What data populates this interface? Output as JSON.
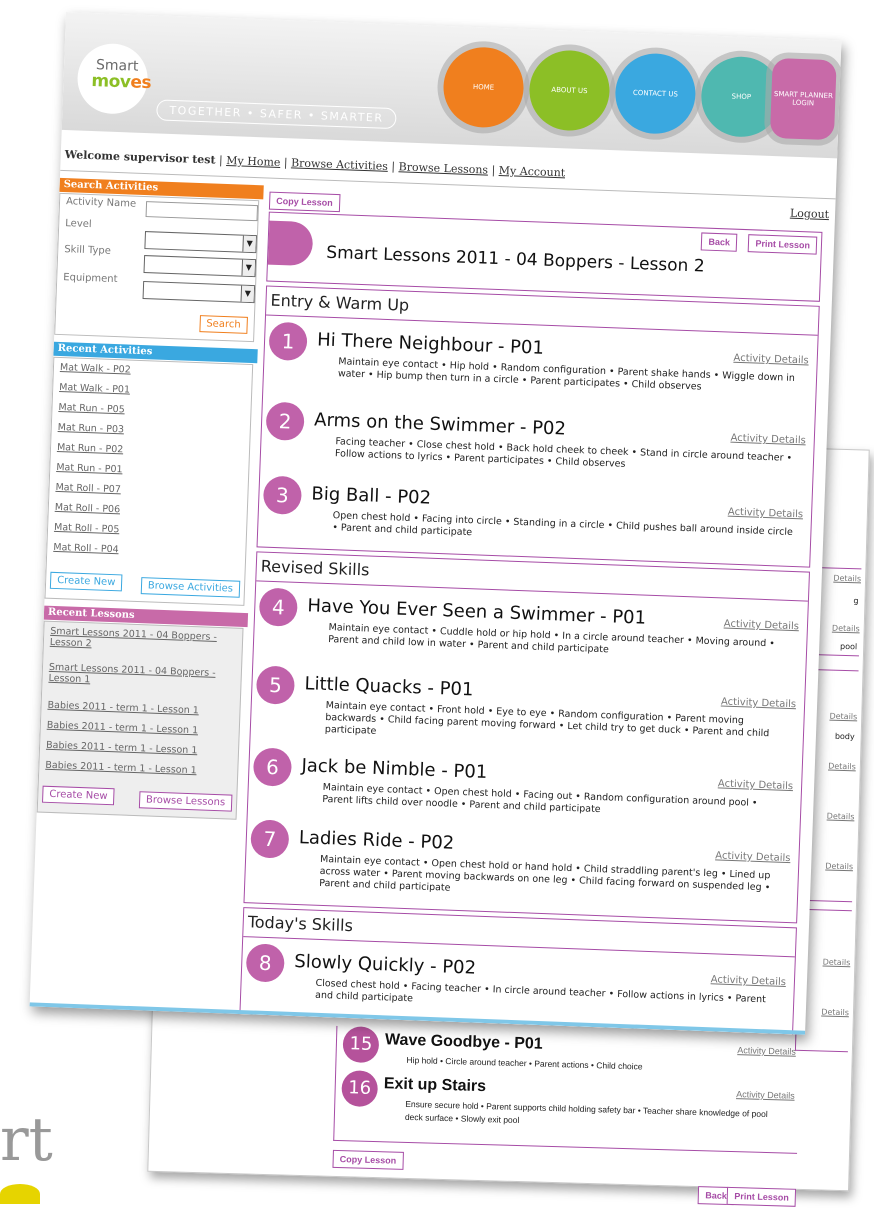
{
  "header": {
    "logo_smart": "Smart",
    "logo_moves": "mov",
    "logo_moves_end": "es",
    "tagline": "TOGETHER • SAFER • SMARTER",
    "nav": [
      {
        "label": "HOME",
        "color": "#f07f1e"
      },
      {
        "label": "ABOUT US",
        "color": "#8cbf26"
      },
      {
        "label": "CONTACT US",
        "color": "#3aa8e0"
      },
      {
        "label": "SHOP",
        "color": "#4fb8b0"
      },
      {
        "label": "SMART PLANNER LOGIN",
        "color": "#c86aa8"
      }
    ]
  },
  "topnav": {
    "welcome": "Welcome supervisor test",
    "sep": "|",
    "links": [
      "My Home",
      "Browse Activities",
      "Browse Lessons",
      "My Account"
    ],
    "logout": "Logout"
  },
  "search": {
    "heading": "Search Activities",
    "activity_name_label": "Activity Name",
    "level_label": "Level",
    "skill_type_label": "Skill Type",
    "equipment_label": "Equipment",
    "search_button": "Search"
  },
  "recent_activities": {
    "heading": "Recent Activities",
    "items": [
      "Mat Walk - P02",
      "Mat Walk - P01",
      "Mat Run - P05",
      "Mat Run - P03",
      "Mat Run - P02",
      "Mat Run - P01",
      "Mat Roll - P07",
      "Mat Roll - P06",
      "Mat Roll - P05",
      "Mat Roll - P04"
    ],
    "create_new": "Create New",
    "browse": "Browse Activities"
  },
  "recent_lessons": {
    "heading": "Recent Lessons",
    "items": [
      "Smart Lessons 2011 - 04 Boppers - Lesson 2",
      "Smart Lessons 2011 - 04 Boppers - Lesson 1",
      "Babies 2011 - term 1 - Lesson 1",
      "Babies 2011 - term 1 - Lesson 1",
      "Babies 2011 - term 1 - Lesson 1",
      "Babies 2011 - term 1 - Lesson 1"
    ],
    "create_new": "Create New",
    "browse": "Browse Lessons"
  },
  "lesson": {
    "copy_lesson": "Copy Lesson",
    "back": "Back",
    "print_lesson": "Print Lesson",
    "title": "Smart Lessons 2011 - 04 Boppers - Lesson 2",
    "activity_details": "Activity Details",
    "sections": [
      {
        "title": "Entry & Warm Up",
        "activities": [
          {
            "num": "1",
            "title": "Hi There Neighbour - P01",
            "desc": "Maintain eye contact • Hip hold • Random configuration • Parent shake hands • Wiggle down in water • Hip bump then turn in a circle • Parent participates • Child observes"
          },
          {
            "num": "2",
            "title": "Arms on the Swimmer - P02",
            "desc": "Facing teacher • Close chest hold • Back hold cheek to cheek • Stand in circle around teacher • Follow actions to lyrics • Parent participates • Child observes"
          },
          {
            "num": "3",
            "title": "Big Ball - P02",
            "desc": "Open chest hold • Facing into circle • Standing in a circle • Child pushes ball around inside circle • Parent and child participate"
          }
        ]
      },
      {
        "title": "Revised Skills",
        "activities": [
          {
            "num": "4",
            "title": "Have You Ever Seen a Swimmer - P01",
            "desc": "Maintain eye contact • Cuddle hold or hip hold • In a circle around teacher • Moving around • Parent and child low in water • Parent and child participate"
          },
          {
            "num": "5",
            "title": "Little Quacks - P01",
            "desc": "Maintain eye contact • Front hold • Eye to eye • Random configuration • Parent moving backwards • Child facing parent moving forward • Let child try to get duck • Parent and child participate"
          },
          {
            "num": "6",
            "title": "Jack be Nimble - P01",
            "desc": "Maintain eye contact • Open chest hold • Facing out • Random configuration around pool • Parent lifts child over noodle • Parent and child participate"
          },
          {
            "num": "7",
            "title": "Ladies Ride - P02",
            "desc": "Maintain eye contact • Open chest hold or hand hold • Child straddling parent's leg • Lined up across water • Parent moving backwards on one leg • Child facing forward on suspended leg • Parent and child participate"
          }
        ]
      },
      {
        "title": "Today's Skills",
        "activities": [
          {
            "num": "8",
            "title": "Slowly Quickly - P02",
            "desc": "Closed chest hold • Facing teacher • In circle around teacher • Follow actions in lyrics • Parent and child participate"
          }
        ]
      }
    ]
  },
  "back_sheet": {
    "details_fragment": "Details",
    "frag_g": "g",
    "frag_pool": "pool",
    "frag_body": "body",
    "item15": {
      "num": "15",
      "title": "Wave Goodbye - P01",
      "desc": "Hip hold • Circle around teacher • Parent actions • Child choice",
      "ad": "Activity Details"
    },
    "item16": {
      "num": "16",
      "title": "Exit up Stairs",
      "desc": "Ensure secure hold • Parent supports child holding safety bar • Teacher share knowledge of pool deck surface • Slowly exit pool",
      "ad": "Activity Details"
    },
    "copy_lesson": "Copy Lesson",
    "back": "Back",
    "print_lesson": "Print Lesson"
  },
  "corner_glyph": "rt"
}
